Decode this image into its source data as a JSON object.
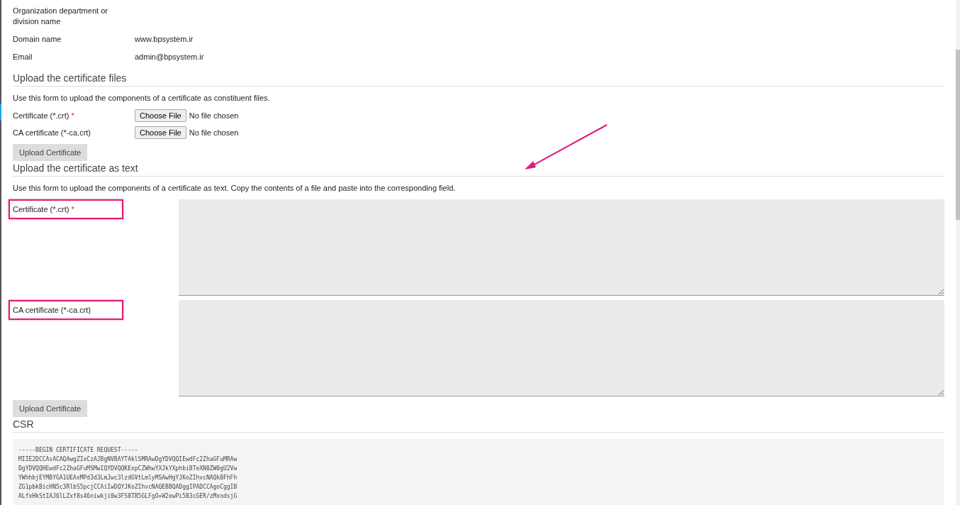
{
  "details": [
    {
      "label": "Organization department or division name"
    },
    {
      "label": "Domain name",
      "value": "www.bpsystem.ir"
    },
    {
      "label": "Email",
      "value": "admin@bpsystem.ir"
    }
  ],
  "file_upload": {
    "title": "Upload the certificate files",
    "description": "Use this form to upload the components of a certificate as constituent files.",
    "fields": [
      {
        "label": "Certificate (*.crt)",
        "required_mark": "*",
        "button": "Choose File",
        "status": "No file chosen"
      },
      {
        "label": "CA certificate (*-ca.crt)",
        "button": "Choose File",
        "status": "No file chosen"
      }
    ],
    "button": "Upload Certificate"
  },
  "text_upload": {
    "title": "Upload the certificate as text",
    "description": "Use this form to upload the components of a certificate as text. Copy the contents of a file and paste into the corresponding field.",
    "fields": [
      {
        "label": "Certificate (*.crt)",
        "required_mark": "*",
        "highlighted": true
      },
      {
        "label": "CA certificate (*-ca.crt)",
        "highlighted": true
      }
    ],
    "button": "Upload Certificate"
  },
  "csr": {
    "title": "CSR",
    "lines": [
      "-----BEGIN CERTIFICATE REQUEST-----",
      "MIIE2DCCAsACAQAwgZIxCzAJBgNVBAYTAklSMRAwDgYDVQQIEwdFc2ZhaGFuMRAw",
      "DgYDVQQHEwdFc2ZhaGFuMSMwIQYDVQQKExpCZWhwYXJkYXphbiBTeXN0ZW0gU2Vw",
      "YWhhbjEYMBYGA1UEAxMPd3d3LmJwc3lzdGVtLmlyMSAwHgYJKoZIhvcNAQkBFhFh",
      "ZG1pbkBicHN5c3RlbS5pcjCCAiIwDQYJKoZIhvcNAQEBBQADggIPADCCAgoCggIB",
      "ALfxHkStIAJ6lLZxf8s46niwkji0w3FS8TB5GLFgO+W2ewPi5B3cGER/zMxndsjG"
    ]
  }
}
